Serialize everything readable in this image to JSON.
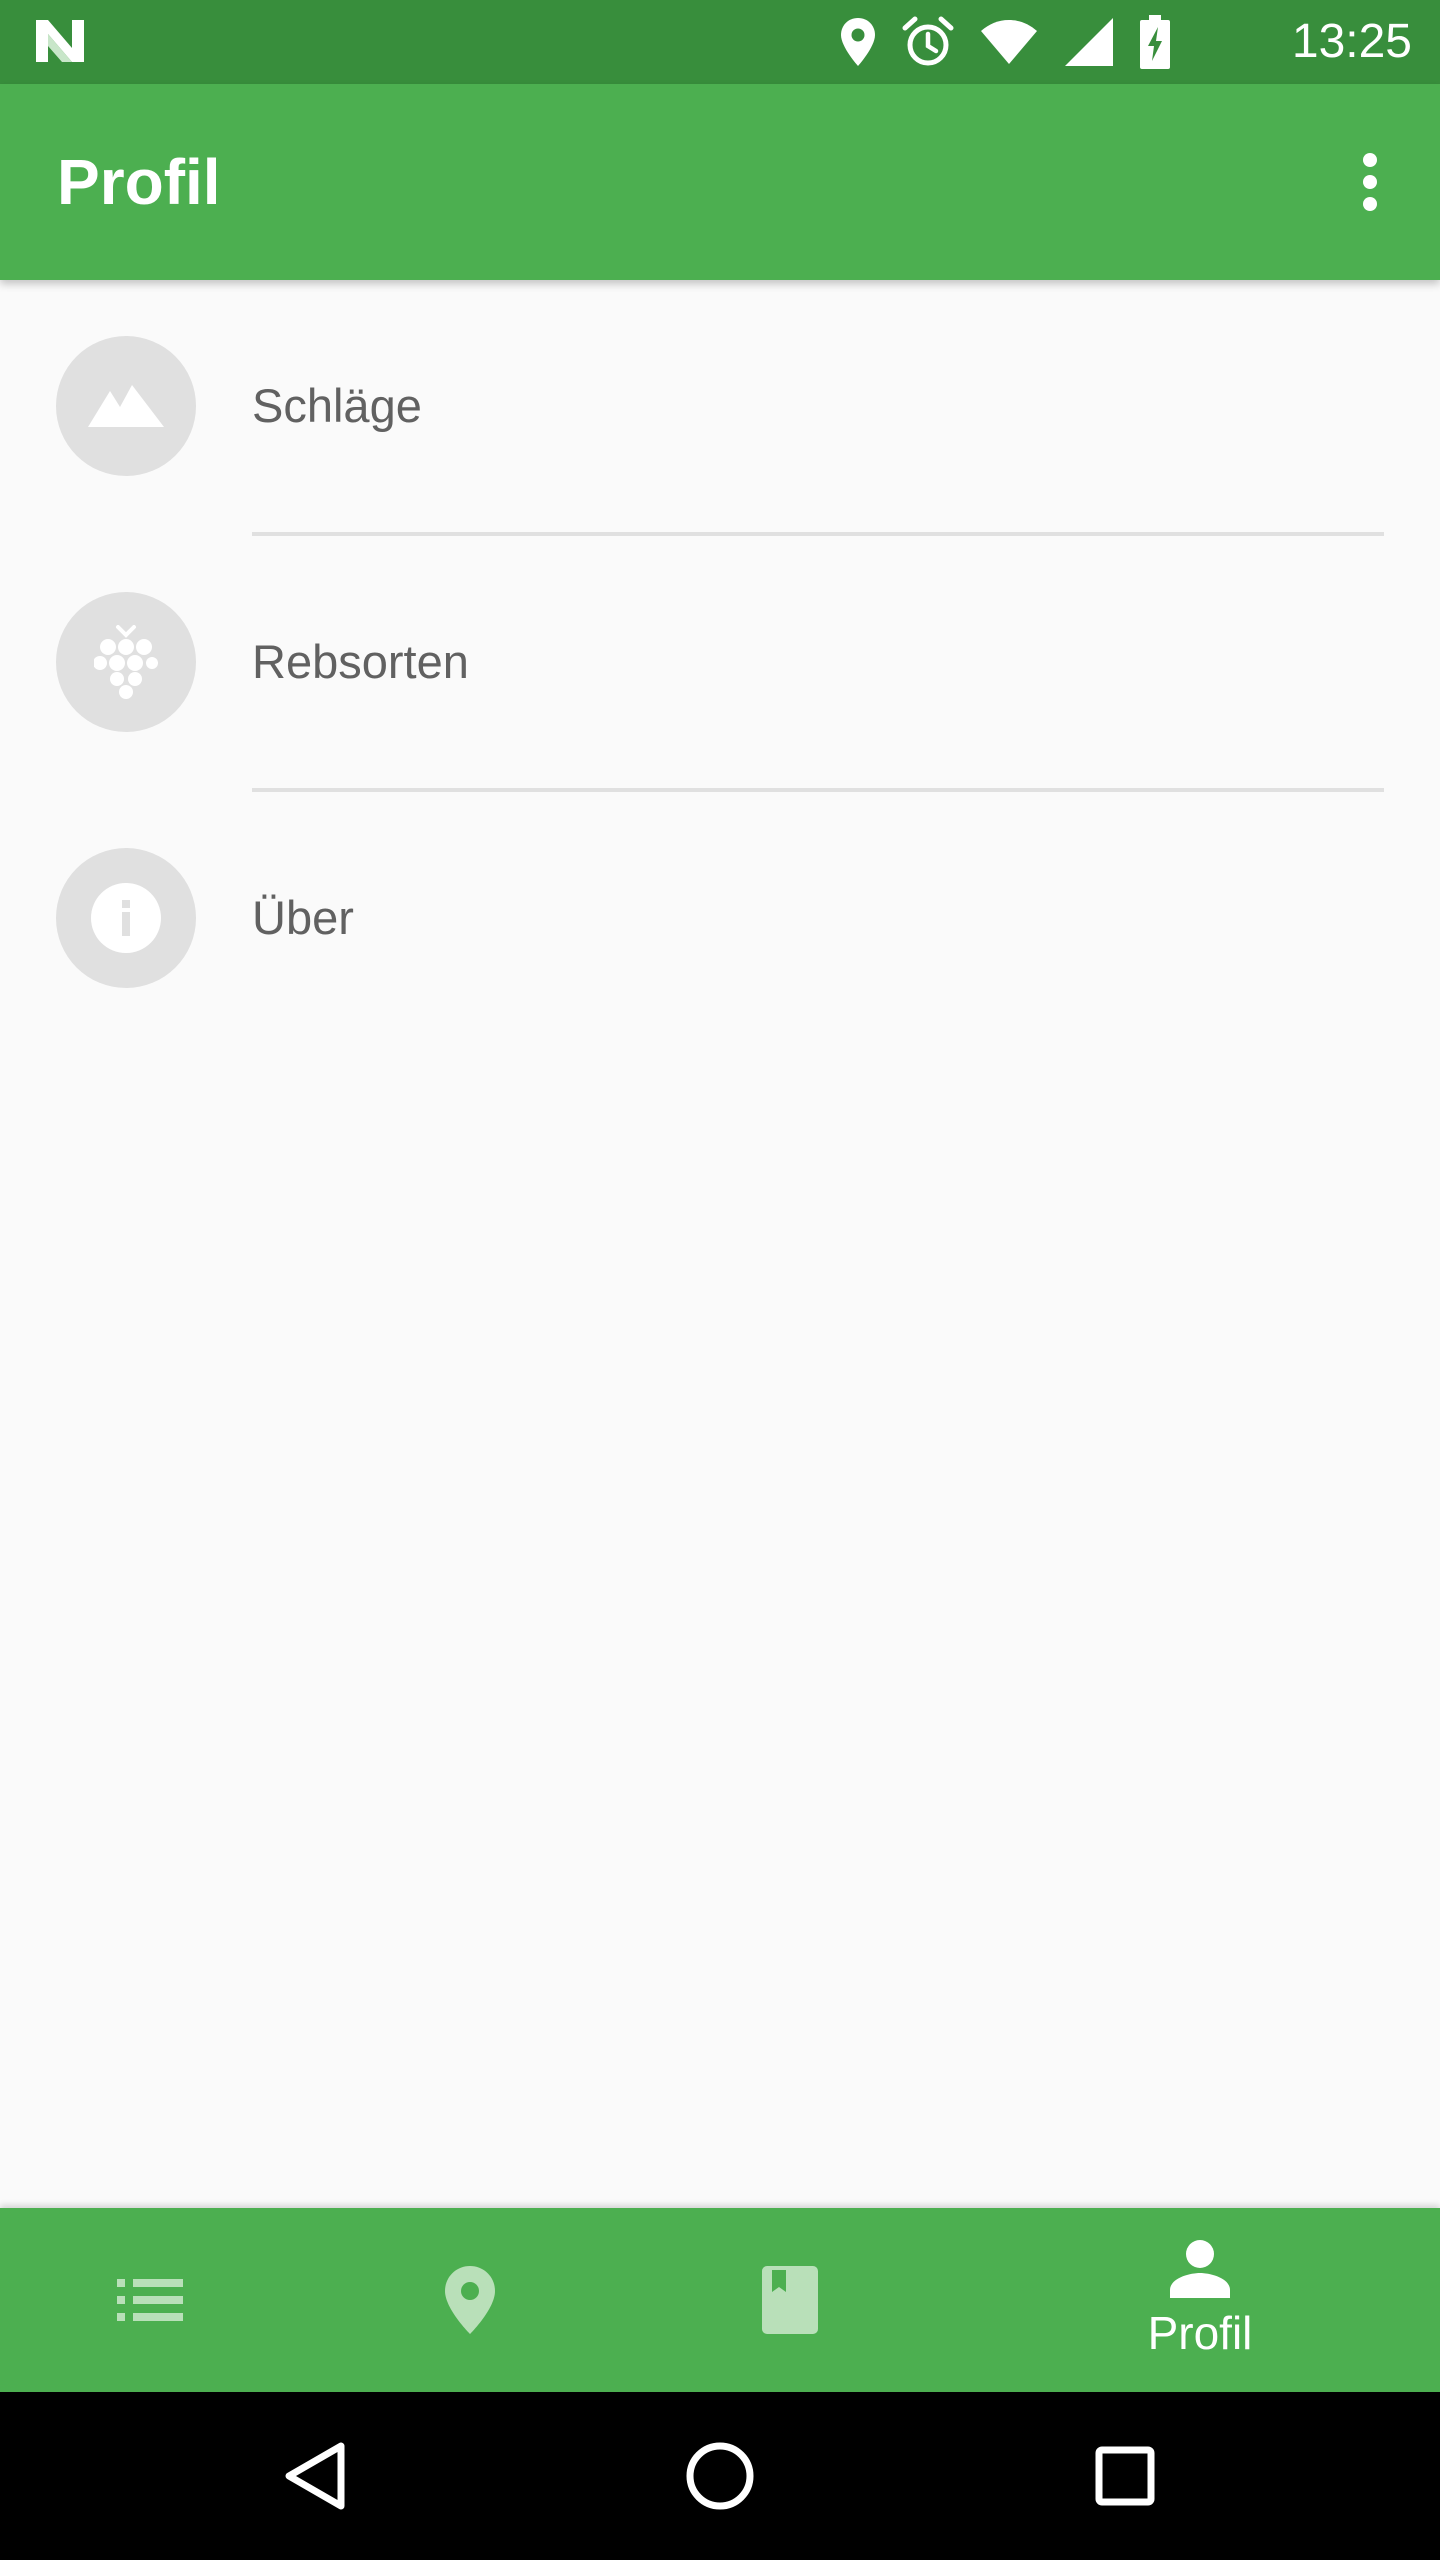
{
  "status_bar": {
    "time": "13:25",
    "icons": [
      "n-logo-icon",
      "location-icon",
      "alarm-icon",
      "wifi-icon",
      "signal-icon",
      "battery-charging-icon"
    ]
  },
  "app_bar": {
    "title": "Profil",
    "overflow_icon": "more-vert-icon"
  },
  "list": {
    "items": [
      {
        "label": "Schläge",
        "icon": "terrain-icon"
      },
      {
        "label": "Rebsorten",
        "icon": "grapes-icon"
      },
      {
        "label": "Über",
        "icon": "info-icon"
      }
    ]
  },
  "bottom_nav": {
    "items": [
      {
        "icon": "list-icon",
        "label": ""
      },
      {
        "icon": "map-pin-icon",
        "label": ""
      },
      {
        "icon": "book-icon",
        "label": ""
      },
      {
        "icon": "person-icon",
        "label": "Profil",
        "active": true
      }
    ]
  },
  "system_nav": [
    "back-icon",
    "home-icon",
    "recents-icon"
  ],
  "colors": {
    "status_bar": "#388e3c",
    "primary": "#4caf50",
    "background": "#fafafa",
    "avatar": "#e0e0e0",
    "text": "#616161",
    "inactive_icon": "#b9e0b9"
  }
}
